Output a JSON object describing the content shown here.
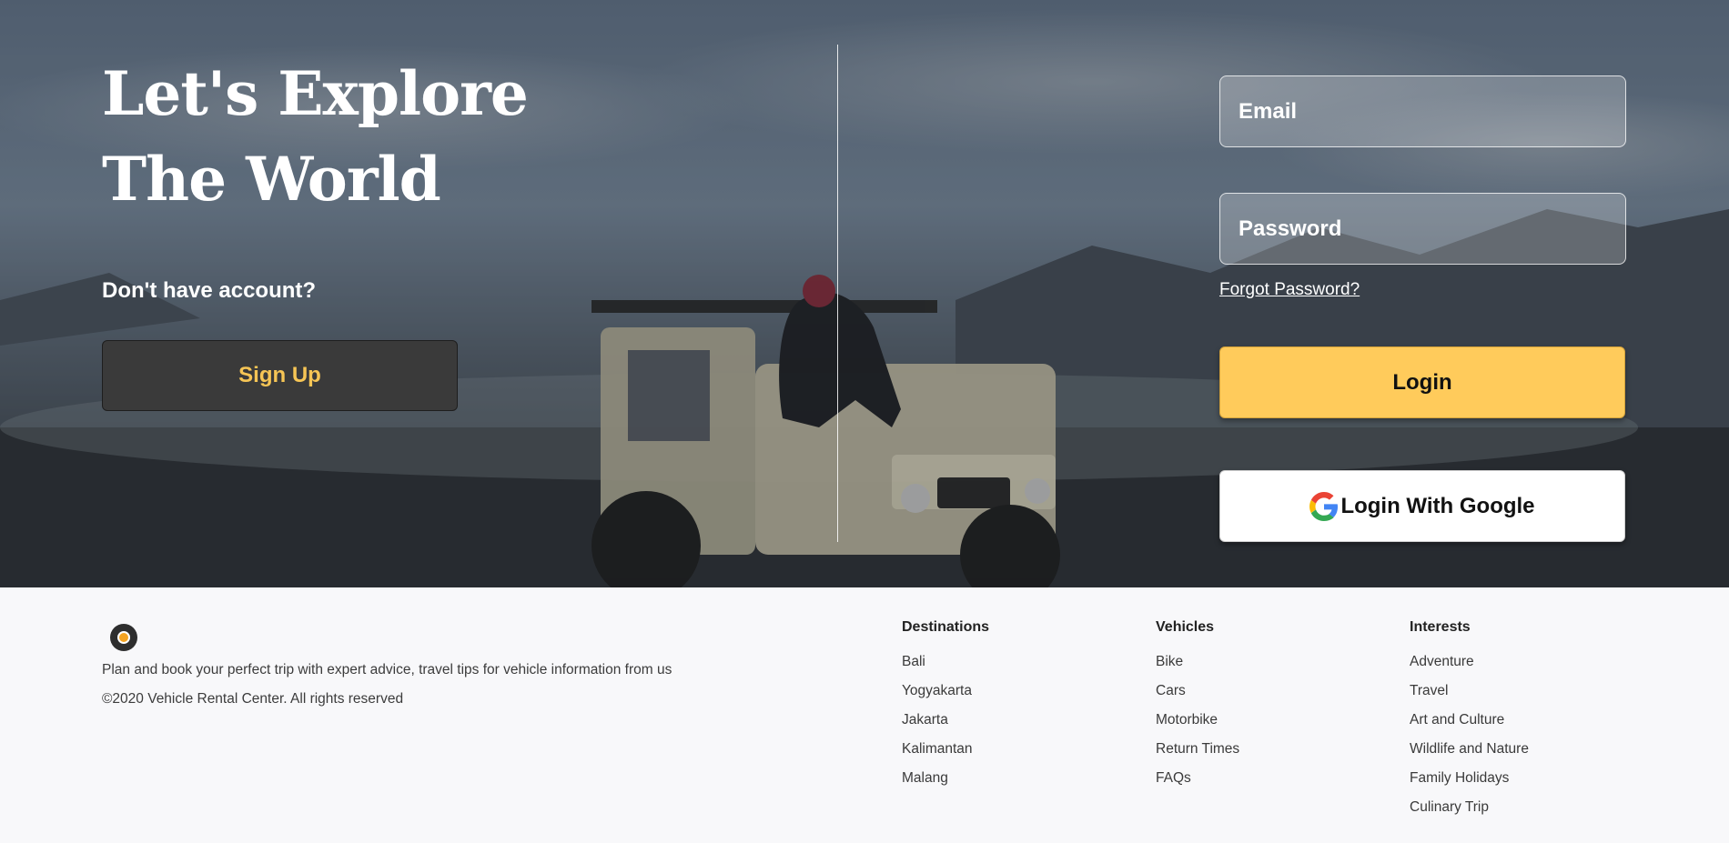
{
  "hero": {
    "headline_line1": "Let's Explore",
    "headline_line2": "The World",
    "no_account": "Don't have account?",
    "signup_label": "Sign Up"
  },
  "login": {
    "email_placeholder": "Email",
    "password_placeholder": "Password",
    "forgot_label": "Forgot Password?",
    "login_label": "Login",
    "google_label": "Login With Google"
  },
  "footer": {
    "tagline": "Plan and book your perfect trip with expert advice, travel tips for vehicle information from us",
    "copyright": "©2020 Vehicle Rental Center. All rights reserved",
    "columns": [
      {
        "title": "Destinations",
        "items": [
          "Bali",
          "Yogyakarta",
          "Jakarta",
          "Kalimantan",
          "Malang"
        ]
      },
      {
        "title": "Vehicles",
        "items": [
          "Bike",
          "Cars",
          "Motorbike",
          "Return Times",
          "FAQs"
        ]
      },
      {
        "title": "Interests",
        "items": [
          "Adventure",
          "Travel",
          "Art and Culture",
          "Wildlife and Nature",
          "Family Holidays",
          "Culinary Trip"
        ]
      }
    ]
  },
  "colors": {
    "accent_yellow": "#ffcb5b",
    "signup_text": "#f6c555",
    "dark_button": "#3a3a3a",
    "logo_dot": "#f4a321"
  },
  "icons": {
    "google": "google-g-icon",
    "logo": "brand-logo-icon"
  }
}
